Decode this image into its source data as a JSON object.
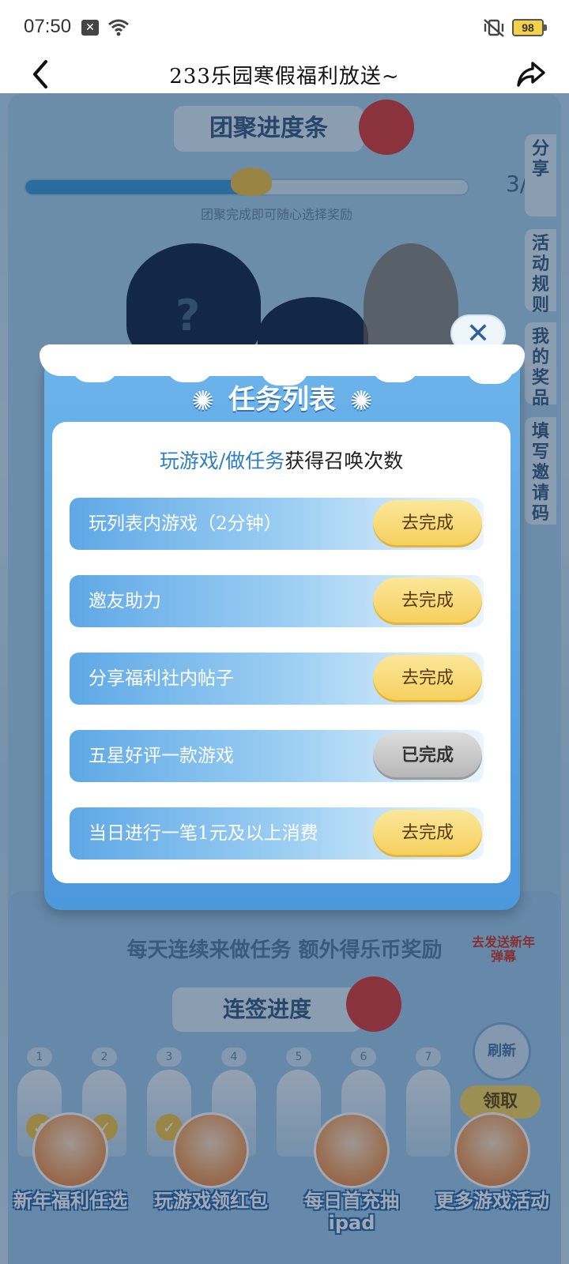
{
  "status_bar": {
    "time": "07:50",
    "notification_icon": "x-icon",
    "battery": "98"
  },
  "title_bar": {
    "title": "233乐园寒假福利放送~"
  },
  "background": {
    "header_pill": "团聚进度条",
    "progress_count": "3/",
    "progress_hint": "团聚完成即可随心选择奖励",
    "progress_fraction": 0.5,
    "side_tabs": [
      "分享",
      "活动规则",
      "我的奖品",
      "填写邀请码"
    ],
    "bottom_title": "每天连续来做任务 额外得乐币奖励",
    "sign_pill": "连签进度",
    "danmu_label": "去发送新年弹幕",
    "refresh_label": "刷新",
    "claim_label": "领取",
    "days": [
      "1",
      "2",
      "3",
      "4",
      "5",
      "6",
      "7"
    ],
    "bottom_nav": [
      {
        "label": "新年福利任选"
      },
      {
        "label": "玩游戏领红包"
      },
      {
        "label": "每日首充抽ipad"
      },
      {
        "label": "更多游戏活动"
      }
    ]
  },
  "modal": {
    "title": "任务列表",
    "subtitle_highlight": "玩游戏/做任务",
    "subtitle_rest": "获得召唤次数",
    "close_label": "✕",
    "tasks": [
      {
        "name": "玩列表内游戏（2分钟）",
        "action": "去完成",
        "done": false
      },
      {
        "name": "邀友助力",
        "action": "去完成",
        "done": false
      },
      {
        "name": "分享福利社内帖子",
        "action": "去完成",
        "done": false
      },
      {
        "name": "五星好评一款游戏",
        "action": "已完成",
        "done": true
      },
      {
        "name": "当日进行一笔1元及以上消费",
        "action": "去完成",
        "done": false
      }
    ]
  },
  "colors": {
    "accent_blue": "#4c98dc",
    "button_yellow": "#f6cf5c",
    "button_done_gray": "#b5b5b5"
  }
}
